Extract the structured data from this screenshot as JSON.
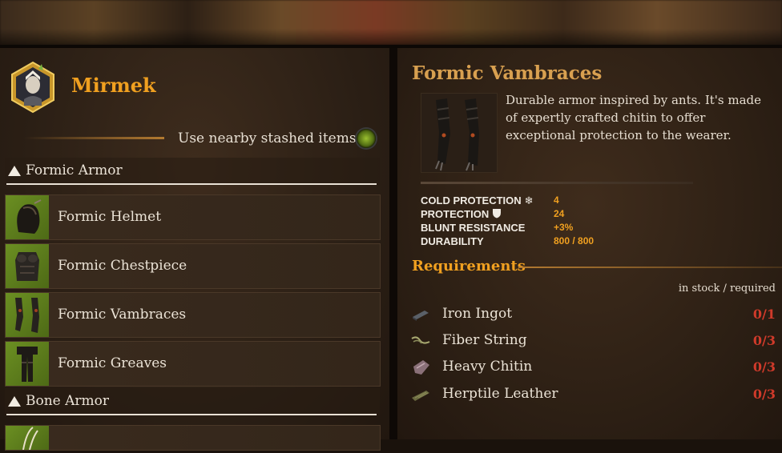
{
  "character": {
    "name": "Mirmek",
    "portrait_icon": "elf-portrait-icon"
  },
  "nearby": {
    "label": "Use nearby stashed items",
    "enabled": true
  },
  "categories": [
    {
      "label": "Formic Armor",
      "items": [
        {
          "name": "Formic Helmet",
          "icon": "helmet-icon"
        },
        {
          "name": "Formic Chestpiece",
          "icon": "chestpiece-icon"
        },
        {
          "name": "Formic Vambraces",
          "icon": "vambraces-icon"
        },
        {
          "name": "Formic Greaves",
          "icon": "greaves-icon"
        }
      ]
    },
    {
      "label": "Bone Armor",
      "items": []
    }
  ],
  "detail": {
    "title": "Formic Vambraces",
    "description": "Durable armor inspired by ants. It's made of expertly crafted chitin to offer exceptional protection to the wearer.",
    "stats": [
      {
        "label": "COLD PROTECTION",
        "icon": "snowflake-icon",
        "value": "4"
      },
      {
        "label": "PROTECTION",
        "icon": "shield-icon",
        "value": "24"
      },
      {
        "label": "BLUNT RESISTANCE",
        "icon": "",
        "value": "+3%"
      },
      {
        "label": "DURABILITY",
        "icon": "",
        "value": "800 / 800"
      }
    ]
  },
  "requirements": {
    "title": "Requirements",
    "header": "in stock / required",
    "items": [
      {
        "name": "Iron Ingot",
        "count": "0/1",
        "icon": "iron-ingot-icon"
      },
      {
        "name": "Fiber String",
        "count": "0/3",
        "icon": "fiber-string-icon"
      },
      {
        "name": "Heavy Chitin",
        "count": "0/3",
        "icon": "heavy-chitin-icon"
      },
      {
        "name": "Herptile Leather",
        "count": "0/3",
        "icon": "herptile-leather-icon"
      }
    ]
  },
  "colors": {
    "accent_orange": "#f0a020",
    "item_thumb_green": "#5a7a1a",
    "missing_red": "#d03a2a"
  }
}
